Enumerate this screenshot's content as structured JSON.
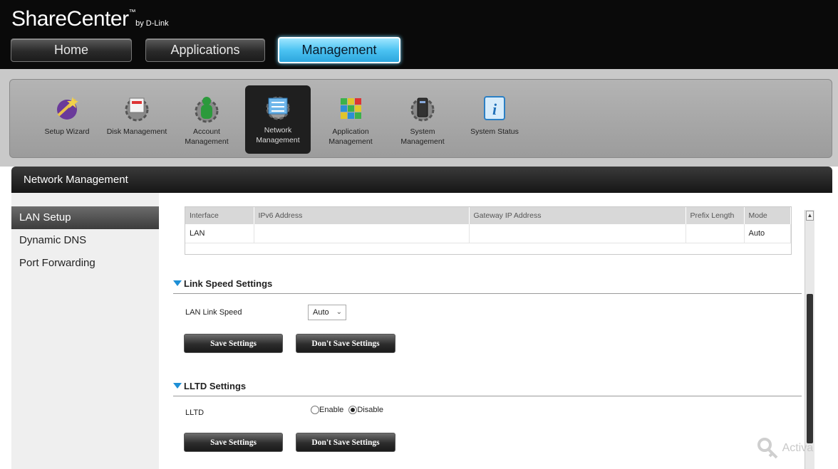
{
  "header": {
    "logo": {
      "name": "ShareCenter",
      "tm": "™",
      "by": "by D-Link"
    },
    "tabs": [
      {
        "label": "Home"
      },
      {
        "label": "Applications"
      },
      {
        "label": "Management"
      }
    ],
    "active_tab_color": "#4cc3f2"
  },
  "toolbar": {
    "items": [
      {
        "label": "Setup Wizard",
        "icon": "wizard-icon"
      },
      {
        "label": "Disk Management",
        "icon": "disk-gear-icon"
      },
      {
        "label": "Account Management",
        "icon": "account-gear-icon"
      },
      {
        "label": "Network Management",
        "icon": "network-gear-icon"
      },
      {
        "label": "Application Management",
        "icon": "app-grid-icon"
      },
      {
        "label": "System Management",
        "icon": "system-gear-icon"
      },
      {
        "label": "System Status",
        "icon": "info-icon"
      }
    ]
  },
  "panel": {
    "title": "Network Management",
    "sidebar": [
      {
        "label": "LAN Setup"
      },
      {
        "label": "Dynamic DNS"
      },
      {
        "label": "Port Forwarding"
      }
    ]
  },
  "table": {
    "headers": [
      "Interface",
      "IPv6 Address",
      "Gateway IP Address",
      "Prefix Length",
      "Mode"
    ],
    "rows": [
      [
        "LAN",
        "",
        "",
        "",
        "Auto"
      ]
    ]
  },
  "link_speed": {
    "title": "Link Speed Settings",
    "label": "LAN  Link Speed",
    "value": "Auto",
    "save": "Save Settings",
    "dont_save": "Don't Save Settings"
  },
  "lltd": {
    "title": "LLTD Settings",
    "label": "LLTD",
    "enable": "Enable",
    "disable": "Disable",
    "selected": "Disable",
    "save": "Save Settings",
    "dont_save": "Don't Save Settings"
  },
  "watermark": "Activa"
}
